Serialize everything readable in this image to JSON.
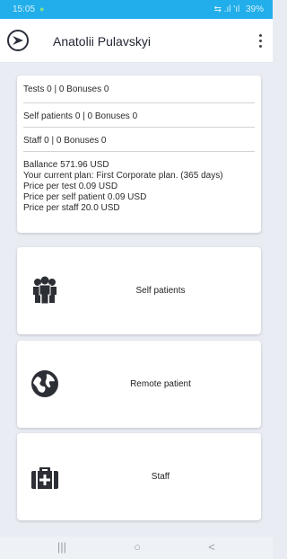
{
  "status_bar": {
    "time": "15:05",
    "notification_icon": "android-icon",
    "signal": "⇆ .ıl 'ıl",
    "battery": "39%"
  },
  "app_bar": {
    "title": "Anatolii Pulavskyi",
    "menu_icon": "more-vert-icon"
  },
  "summary": {
    "tests": "Tests 0 | 0 Bonuses 0",
    "self_patients": "Self patients 0 | 0 Bonuses 0",
    "staff": "Staff 0 | 0 Bonuses 0",
    "balance": "Ballance 571.96 USD",
    "plan": "Your current plan: First Corporate plan. (365 days)",
    "price_test": "Price per test 0.09 USD",
    "price_self_patient": "Price per self patient 0.09 USD",
    "price_staff": "Price per staff 20.0 USD"
  },
  "actions": [
    {
      "label": "Self patients",
      "icon": "group-icon"
    },
    {
      "label": "Remote patient",
      "icon": "globe-icon"
    },
    {
      "label": "Staff",
      "icon": "medical-kit-icon"
    }
  ],
  "nav_bar": {
    "recents": "|||",
    "home": "○",
    "back": "<"
  },
  "colors": {
    "status_bar": "#22aeea",
    "background": "#e9edf3",
    "card": "#ffffff",
    "icon": "#2d2f36"
  }
}
